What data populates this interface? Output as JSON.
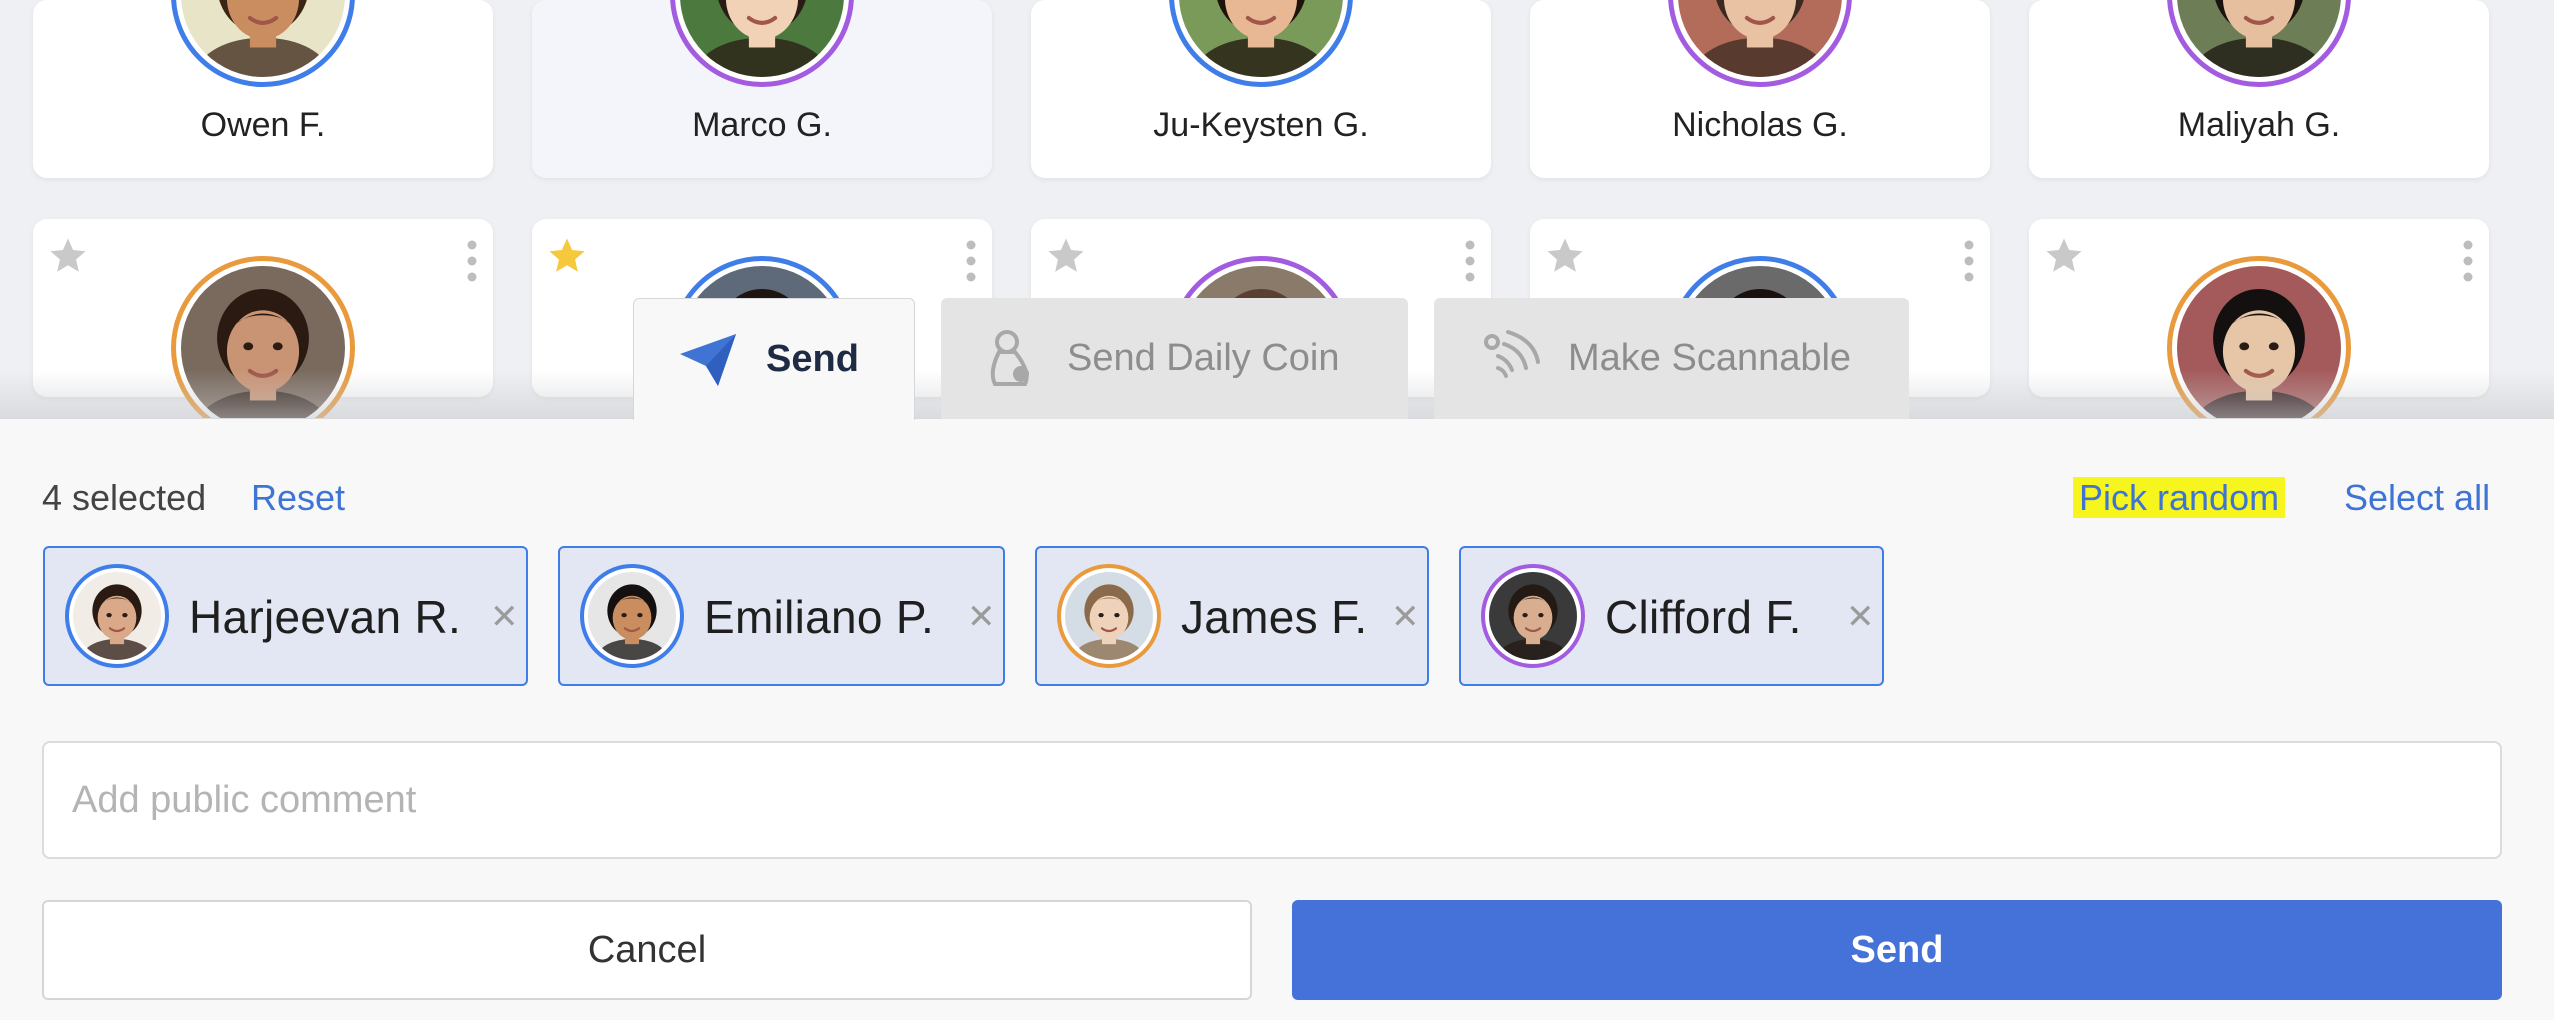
{
  "colors": {
    "ring_blue": "#3f7ee8",
    "ring_purple": "#a35be0",
    "ring_orange": "#e89a3c",
    "link_blue": "#3f74d4",
    "primary_button": "#4572d8",
    "chip_background": "#e3e7f3",
    "highlight_yellow": "#f6f61e",
    "star_active": "#f5c93b",
    "star_inactive": "#c9c9c9"
  },
  "students_row1": [
    {
      "name": "Owen F.",
      "ring": "blue",
      "skin": "#c98d5f",
      "hair": "#3a2416",
      "bg": "#e8e4c8",
      "selected": false
    },
    {
      "name": "Marco G.",
      "ring": "purple",
      "skin": "#f2d2b6",
      "hair": "#2a1c14",
      "bg": "#4c7a3e",
      "selected": true
    },
    {
      "name": "Ju-Keysten G.",
      "ring": "blue",
      "skin": "#e8b895",
      "hair": "#1e120c",
      "bg": "#7a9a5a",
      "selected": false
    },
    {
      "name": "Nicholas G.",
      "ring": "purple",
      "skin": "#e9c2a4",
      "hair": "#3a2a20",
      "bg": "#b36b5a",
      "selected": false
    },
    {
      "name": "Maliyah G.",
      "ring": "purple",
      "skin": "#e6c09e",
      "hair": "#1a1410",
      "bg": "#6d7d55",
      "selected": false
    }
  ],
  "students_row2": [
    {
      "ring": "orange",
      "starred": false,
      "skin": "#c99474",
      "hair": "#2a1a12",
      "bg": "#7a6a5e"
    },
    {
      "ring": "blue",
      "starred": true,
      "skin": "#c99474",
      "hair": "#1e1410",
      "bg": "#5e6a7a"
    },
    {
      "ring": "purple",
      "starred": false,
      "skin": "#d9b08c",
      "hair": "#5a4030",
      "bg": "#8a7a6a"
    },
    {
      "ring": "blue",
      "starred": false,
      "skin": "#c99474",
      "hair": "#1a120e",
      "bg": "#6a6a6a"
    },
    {
      "ring": "orange",
      "starred": false,
      "skin": "#e6c6a6",
      "hair": "#141010",
      "bg": "#a45a5a"
    }
  ],
  "tabs": [
    {
      "label": "Send",
      "icon": "paper-plane-icon",
      "active": true
    },
    {
      "label": "Send Daily Coin",
      "icon": "coin-bag-icon",
      "active": false
    },
    {
      "label": "Make Scannable",
      "icon": "scan-waves-icon",
      "active": false
    }
  ],
  "selection": {
    "count_text": "4 selected",
    "reset_label": "Reset",
    "pick_random_label": "Pick random",
    "select_all_label": "Select all"
  },
  "chips": [
    {
      "name": "Harjeevan R.",
      "ring": "blue",
      "skin": "#d9a98a",
      "hair": "#2a1a12",
      "bg": "#f2ece6"
    },
    {
      "name": "Emiliano P.",
      "ring": "blue",
      "skin": "#c98d5f",
      "hair": "#141010",
      "bg": "#e6e6e6"
    },
    {
      "name": "James F.",
      "ring": "orange",
      "skin": "#efd2ba",
      "hair": "#8a6a4a",
      "bg": "#d4dde6"
    },
    {
      "name": "Clifford F.",
      "ring": "purple",
      "skin": "#d9ae90",
      "hair": "#241a14",
      "bg": "#3a3a3a"
    }
  ],
  "comment": {
    "placeholder": "Add public comment",
    "value": ""
  },
  "buttons": {
    "cancel": "Cancel",
    "send": "Send"
  }
}
